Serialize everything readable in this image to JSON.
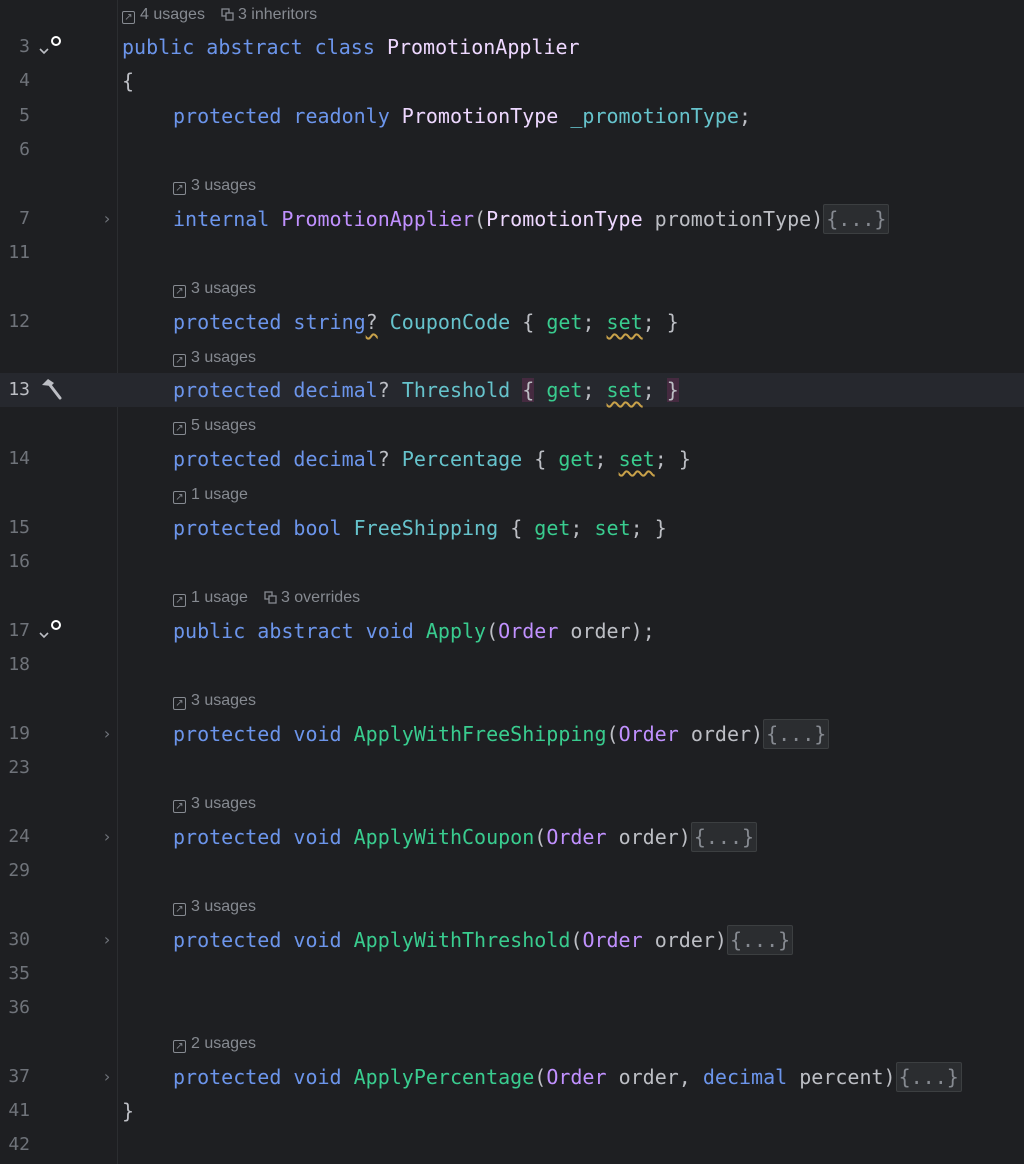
{
  "editor": {
    "lines": [
      {
        "no": "3"
      },
      {
        "no": "4"
      },
      {
        "no": "5"
      },
      {
        "no": "6"
      },
      {
        "no": "7"
      },
      {
        "no": "11"
      },
      {
        "no": "12"
      },
      {
        "no": "13"
      },
      {
        "no": "14"
      },
      {
        "no": "15"
      },
      {
        "no": "16"
      },
      {
        "no": "17"
      },
      {
        "no": "18"
      },
      {
        "no": "19"
      },
      {
        "no": "23"
      },
      {
        "no": "24"
      },
      {
        "no": "29"
      },
      {
        "no": "30"
      },
      {
        "no": "35"
      },
      {
        "no": "36"
      },
      {
        "no": "37"
      },
      {
        "no": "41"
      },
      {
        "no": "42"
      }
    ],
    "hints": {
      "class_usages": "4 usages",
      "class_inheritors": "3 inheritors",
      "ctor": "3 usages",
      "coupon": "3 usages",
      "threshold": "3 usages",
      "percentage": "5 usages",
      "freeshipping": "1 usage",
      "apply_usages": "1 usage",
      "apply_overrides": "3 overrides",
      "applyfree": "3 usages",
      "applycoupon": "3 usages",
      "applythreshold": "3 usages",
      "applypercentage": "2 usages"
    },
    "tokens": {
      "public": "public",
      "abstract": "abstract",
      "class": "class",
      "class_name": "PromotionApplier",
      "open_brace": "{",
      "close_brace": "}",
      "protected": "protected",
      "readonly": "readonly",
      "promotion_type": "PromotionType",
      "field_name": "_promotionType",
      "semicolon": ";",
      "internal": "internal",
      "ctor_name": "PromotionApplier",
      "ctor_param": "promotionType",
      "string": "string",
      "decimal": "decimal",
      "bool": "bool",
      "void": "void",
      "nullable": "?",
      "coupon_code": "CouponCode",
      "threshold": "Threshold",
      "percentage": "Percentage",
      "free_shipping": "FreeShipping",
      "get": "get",
      "set": "set",
      "apply": "Apply",
      "order_type": "Order",
      "order_param": "order",
      "apply_free": "ApplyWithFreeShipping",
      "apply_coupon": "ApplyWithCoupon",
      "apply_threshold": "ApplyWithThreshold",
      "apply_percentage": "ApplyPercentage",
      "percent_param": "percent",
      "folded": "{...}"
    }
  }
}
